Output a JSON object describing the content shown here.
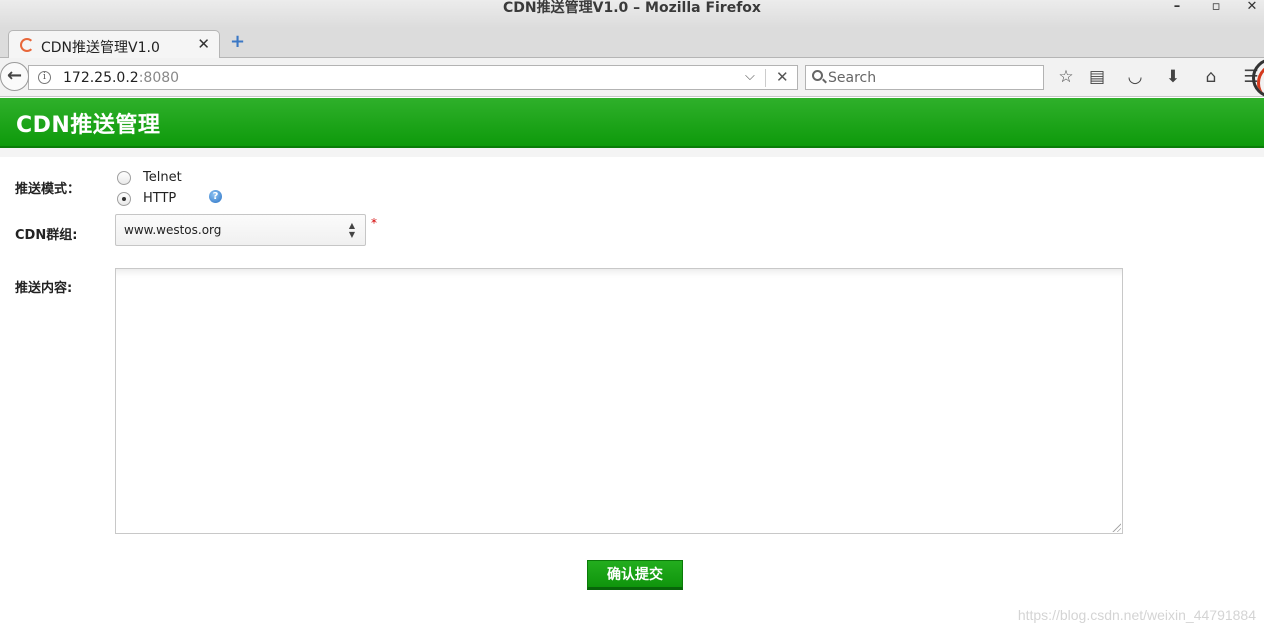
{
  "window": {
    "title": "CDN推送管理V1.0 – Mozilla Firefox",
    "minimize": "–",
    "maximize": "▫",
    "close": "✕"
  },
  "tab": {
    "title": "CDN推送管理V1.0",
    "close": "✕",
    "new_tab": "+"
  },
  "navbar": {
    "back": "←",
    "url_host": "172.25.0.2",
    "url_port": ":8080",
    "info": "i",
    "dropdown": "⌵",
    "stop": "✕",
    "search_placeholder": "Search",
    "icons": {
      "bookmark": "☆",
      "reading_list": "▤",
      "pocket": "◡",
      "download": "⬇",
      "home": "⌂",
      "menu": "☰"
    }
  },
  "page": {
    "heading": "CDN推送管理",
    "form": {
      "mode_label": "推送模式：",
      "modes": [
        {
          "label": "Telnet",
          "checked": false
        },
        {
          "label": "HTTP",
          "checked": true
        }
      ],
      "help": "?",
      "group_label": "CDN群组:",
      "group_value": "www.westos.org",
      "required_mark": "*",
      "content_label": "推送内容:",
      "content_value": "",
      "submit_label": "确认提交"
    }
  },
  "watermark": "https://blog.csdn.net/weixin_44791884"
}
